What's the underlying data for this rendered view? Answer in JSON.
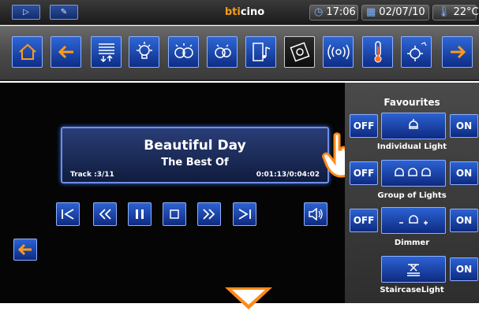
{
  "topbar": {
    "brand_part1": "bti",
    "brand_part2": "cino",
    "time": "17:06",
    "date": "02/07/10",
    "temperature": "22°C"
  },
  "player": {
    "song": "Beautiful Day",
    "album": "The Best Of",
    "track": "Track :3/11",
    "time": "0:01:13/0:04:02"
  },
  "favourites": {
    "title": "Favourites",
    "items": [
      {
        "label": "Individual Light",
        "off": "OFF",
        "on": "ON"
      },
      {
        "label": "Group of Lights",
        "off": "OFF",
        "on": "ON"
      },
      {
        "label": "Dimmer",
        "off": "OFF",
        "on": "ON"
      },
      {
        "label": "StaircaseLight",
        "on": "ON"
      }
    ]
  }
}
